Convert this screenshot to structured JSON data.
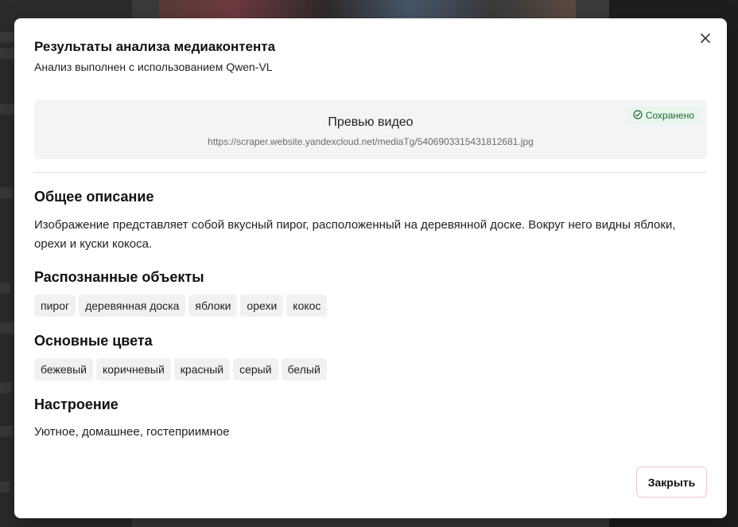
{
  "modal": {
    "title": "Результаты анализа медиаконтента",
    "subtitle": "Анализ выполнен с использованием Qwen-VL",
    "close_icon": "close-icon"
  },
  "preview": {
    "title": "Превью видео",
    "url": "https://scraper.website.yandexcloud.net/mediaTg/5406903315431812681.jpg",
    "badge": "Сохранено",
    "badge_icon": "check-circle-icon"
  },
  "description": {
    "title": "Общее описание",
    "text": "Изображение представляет собой вкусный пирог, расположенный на деревянной доске. Вокруг него видны яблоки, орехи и куски кокоса."
  },
  "objects": {
    "title": "Распознанные объекты",
    "items": [
      "пирог",
      "деревянная доска",
      "яблоки",
      "орехи",
      "кокос"
    ]
  },
  "colors": {
    "title": "Основные цвета",
    "items": [
      "бежевый",
      "коричневый",
      "красный",
      "серый",
      "белый"
    ]
  },
  "mood": {
    "title": "Настроение",
    "text": "Уютное, домашнее, гостеприимное"
  },
  "footer": {
    "close_label": "Закрыть"
  },
  "theme": {
    "badge_bg": "#e8f6ec",
    "badge_fg": "#1f6b35",
    "accent_border": "#efc7cf"
  }
}
